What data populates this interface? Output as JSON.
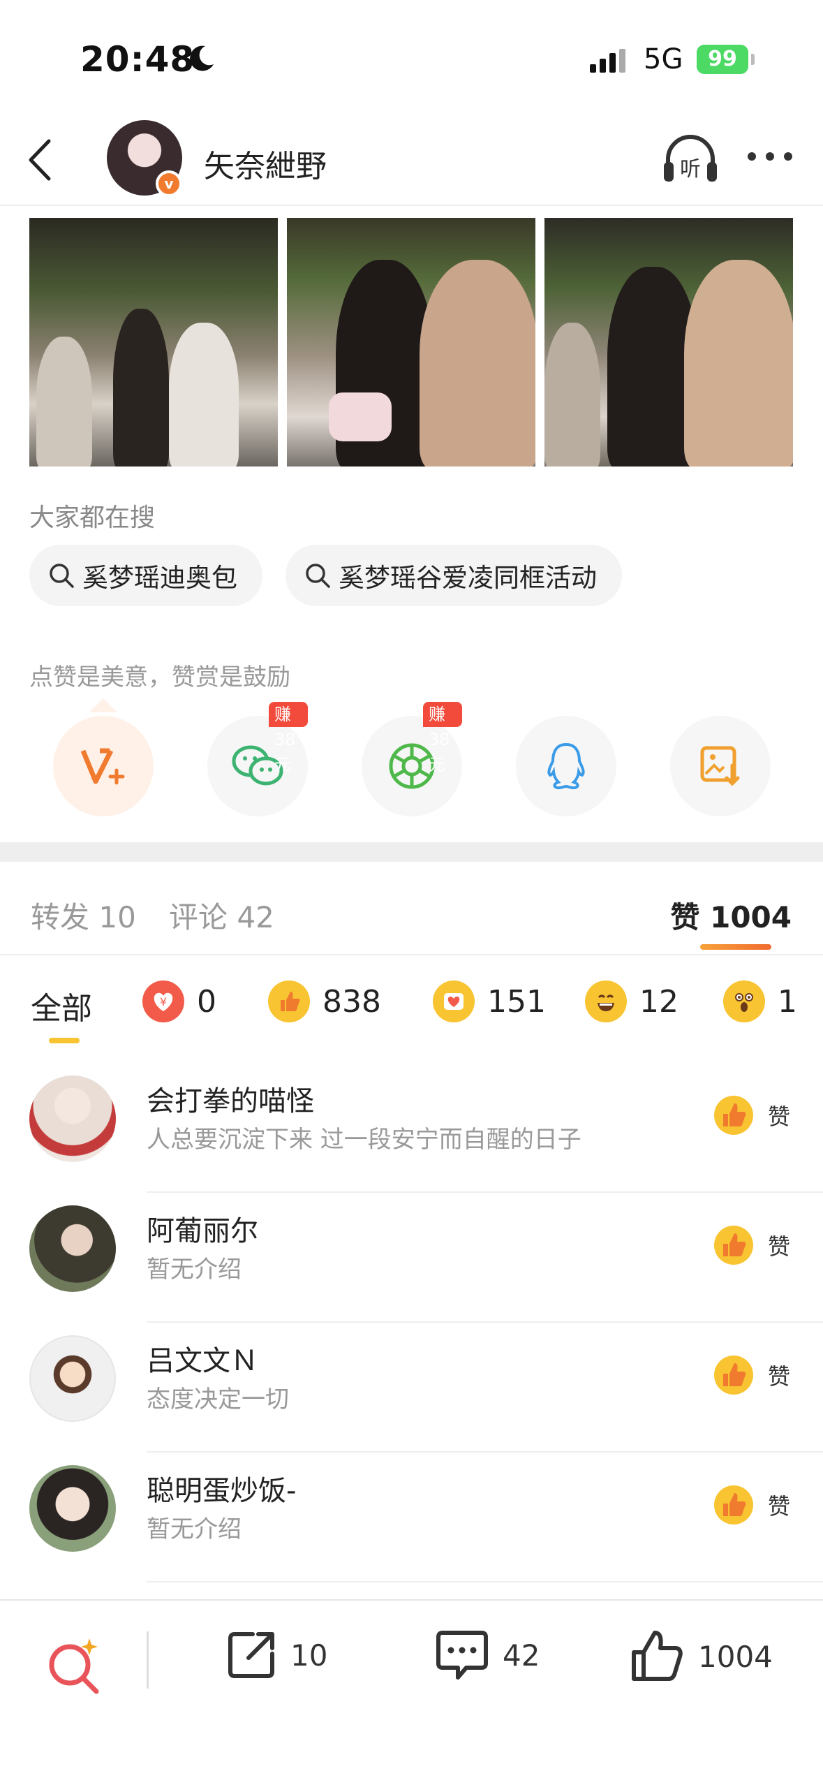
{
  "status_bar": {
    "time": "20:48",
    "network": "5G",
    "battery": "99"
  },
  "nav": {
    "back_icon": "chevron-left-icon",
    "user_name": "矢奈紲野",
    "verified_badge": "v",
    "listen_label": "听"
  },
  "search_section": {
    "title": "大家都在搜",
    "chips": [
      "奚梦瑶迪奥包",
      "奚梦瑶谷爱凌同框活动"
    ]
  },
  "reward_section": {
    "text": "点赞是美意，赞赏是鼓励",
    "earn_badge_1": "赚38元",
    "earn_badge_2": "赚38元",
    "buttons": [
      "v-plus-icon",
      "wechat-icon",
      "moments-icon",
      "qq-icon",
      "save-image-icon"
    ]
  },
  "tabs": {
    "repost_label": "转发 10",
    "comment_label": "评论 42",
    "like_label": "赞 1004"
  },
  "reaction_filters": {
    "all_label": "全部",
    "reward_count": "0",
    "thumb_count": "838",
    "heart_count": "151",
    "laugh_count": "12",
    "surprise_count": "1"
  },
  "likes": [
    {
      "name": "会打拳的喵怪",
      "bio": "人总要沉淀下来 过一段安宁而自醒的日子",
      "like_label": "赞"
    },
    {
      "name": "阿葡丽尔",
      "bio": "暂无介绍",
      "like_label": "赞"
    },
    {
      "name": "吕文文Ｎ",
      "bio": "态度决定一切",
      "like_label": "赞"
    },
    {
      "name": "聪明蛋炒饭-",
      "bio": "暂无介绍",
      "like_label": "赞"
    }
  ],
  "bottom_bar": {
    "repost_count": "10",
    "comment_count": "42",
    "like_count": "1004"
  },
  "colors": {
    "accent_orange": "#f07b2f",
    "thumb_yellow": "#f8c431",
    "earn_red": "#f24b3c",
    "battery_green": "#4cd964"
  }
}
